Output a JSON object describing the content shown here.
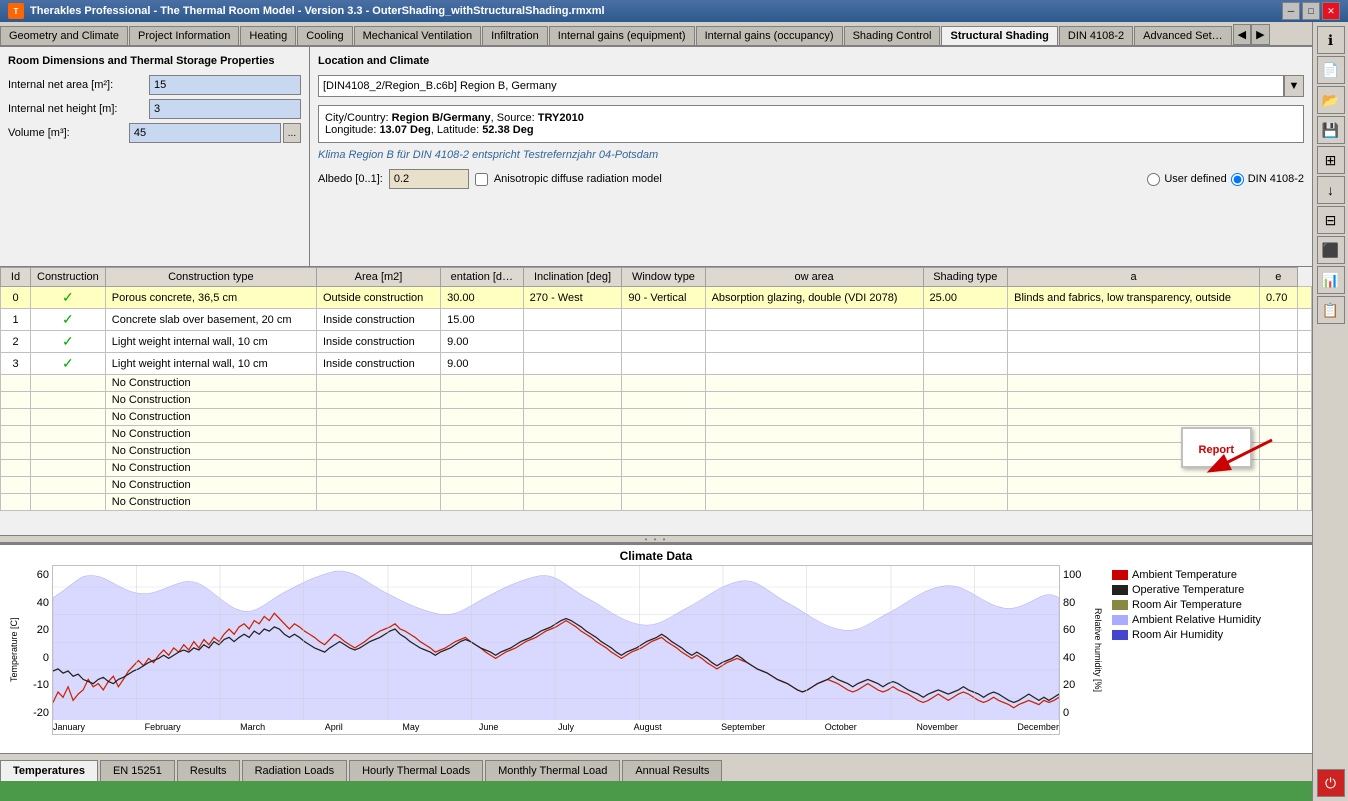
{
  "titleBar": {
    "title": "Therakles Professional - The Thermal Room Model - Version 3.3 - OuterShading_withStructuralShading.rmxml",
    "icon": "T",
    "minimize": "─",
    "maximize": "□",
    "close": "✕"
  },
  "tabs": [
    {
      "label": "Geometry and Climate",
      "active": false
    },
    {
      "label": "Project Information",
      "active": false
    },
    {
      "label": "Heating",
      "active": false
    },
    {
      "label": "Cooling",
      "active": false
    },
    {
      "label": "Mechanical Ventilation",
      "active": false
    },
    {
      "label": "Infiltration",
      "active": false
    },
    {
      "label": "Internal gains (equipment)",
      "active": false
    },
    {
      "label": "Internal gains (occupancy)",
      "active": false
    },
    {
      "label": "Shading Control",
      "active": false
    },
    {
      "label": "Structural Shading",
      "active": true
    },
    {
      "label": "DIN 4108-2",
      "active": false
    },
    {
      "label": "Advanced Set…",
      "active": false
    }
  ],
  "leftPanel": {
    "title": "Room Dimensions and Thermal Storage Properties",
    "fields": [
      {
        "label": "Internal net area [m²]:",
        "value": "15"
      },
      {
        "label": "Internal net height [m]:",
        "value": "3"
      },
      {
        "label": "Volume [m³]:",
        "value": "45"
      }
    ]
  },
  "climatePanel": {
    "title": "Location and Climate",
    "dropdown": "[DIN4108_2/Region_B.c6b] Region B, Germany",
    "infoCity": "Region B/Germany",
    "infoSource": "TRY2010",
    "infoLongitude": "13.07 Deg",
    "infoLatitude": "52.38 Deg",
    "klimaText": "Klima Region B für DIN 4108-2 entspricht Testrefernzjahr 04-Potsdam",
    "albedoLabel": "Albedo  [0..1]:",
    "albedoValue": "0.2",
    "anisotropicLabel": "Anisotropic diffuse radiation model",
    "radioUserDefined": "User defined",
    "radioDIN": "DIN 4108-2",
    "radioDINActive": true
  },
  "table": {
    "headers": [
      "Id",
      "Construction",
      "Construction type",
      "Area [m2]",
      "entation [d…",
      "Inclination [deg]",
      "Window type",
      "ow area",
      "Shading type",
      "a",
      "e"
    ],
    "rows": [
      {
        "id": "0",
        "check": true,
        "construction": "Porous concrete, 36,5 cm",
        "type": "Outside construction",
        "area": "30.00",
        "orient": "270 - West",
        "incl": "90 - Vertical",
        "windowType": "Absorption glazing, double (VDI 2078)",
        "winArea": "25.00",
        "shadingType": "Blinds and fabrics, low transparency, outside",
        "a": "0.70",
        "e": "",
        "bg": "yellow"
      },
      {
        "id": "1",
        "check": true,
        "construction": "Concrete slab over basement, 20 cm",
        "type": "Inside construction",
        "area": "15.00",
        "orient": "",
        "incl": "",
        "windowType": "",
        "winArea": "",
        "shadingType": "",
        "a": "",
        "e": "",
        "bg": "white"
      },
      {
        "id": "2",
        "check": true,
        "construction": "Light weight internal wall, 10 cm",
        "type": "Inside construction",
        "area": "9.00",
        "orient": "",
        "incl": "",
        "windowType": "",
        "winArea": "",
        "shadingType": "",
        "a": "",
        "e": "",
        "bg": "white"
      },
      {
        "id": "3",
        "check": true,
        "construction": "Light weight internal wall, 10 cm",
        "type": "Inside construction",
        "area": "9.00",
        "orient": "",
        "incl": "",
        "windowType": "",
        "winArea": "",
        "shadingType": "",
        "a": "",
        "e": "",
        "bg": "white"
      },
      {
        "id": "",
        "check": false,
        "construction": "No Construction",
        "type": "",
        "area": "",
        "orient": "",
        "incl": "",
        "windowType": "",
        "winArea": "",
        "shadingType": "",
        "a": "",
        "e": "",
        "bg": "empty"
      },
      {
        "id": "",
        "check": false,
        "construction": "No Construction",
        "type": "",
        "area": "",
        "orient": "",
        "incl": "",
        "windowType": "",
        "winArea": "",
        "shadingType": "",
        "a": "",
        "e": "",
        "bg": "empty"
      },
      {
        "id": "",
        "check": false,
        "construction": "No Construction",
        "type": "",
        "area": "",
        "orient": "",
        "incl": "",
        "windowType": "",
        "winArea": "",
        "shadingType": "",
        "a": "",
        "e": "",
        "bg": "empty"
      },
      {
        "id": "",
        "check": false,
        "construction": "No Construction",
        "type": "",
        "area": "",
        "orient": "",
        "incl": "",
        "windowType": "",
        "winArea": "",
        "shadingType": "",
        "a": "",
        "e": "",
        "bg": "empty"
      },
      {
        "id": "",
        "check": false,
        "construction": "No Construction",
        "type": "",
        "area": "",
        "orient": "",
        "incl": "",
        "windowType": "",
        "winArea": "",
        "shadingType": "",
        "a": "",
        "e": "",
        "bg": "empty"
      },
      {
        "id": "",
        "check": false,
        "construction": "No Construction",
        "type": "",
        "area": "",
        "orient": "",
        "incl": "",
        "windowType": "",
        "winArea": "",
        "shadingType": "",
        "a": "",
        "e": "",
        "bg": "empty"
      },
      {
        "id": "",
        "check": false,
        "construction": "No Construction",
        "type": "",
        "area": "",
        "orient": "",
        "incl": "",
        "windowType": "",
        "winArea": "",
        "shadingType": "",
        "a": "",
        "e": "",
        "bg": "empty"
      },
      {
        "id": "",
        "check": false,
        "construction": "No Construction",
        "type": "",
        "area": "",
        "orient": "",
        "incl": "",
        "windowType": "",
        "winArea": "",
        "shadingType": "",
        "a": "",
        "e": "",
        "bg": "empty"
      }
    ]
  },
  "report": {
    "label": "Report"
  },
  "chart": {
    "title": "Climate Data",
    "yLeftLabel": "Temperature [C]",
    "yRightLabel": "Relative humidity [%]",
    "xLabels": [
      "January",
      "February",
      "March",
      "April",
      "May",
      "June",
      "July",
      "August",
      "September",
      "October",
      "November",
      "December"
    ],
    "yLeftTicks": [
      "60",
      "40",
      "20",
      "0",
      "-20"
    ],
    "yRightTicks": [
      "100",
      "80",
      "60",
      "40",
      "20",
      "0"
    ],
    "legend": [
      {
        "color": "#cc0000",
        "label": "Ambient Temperature"
      },
      {
        "color": "#222222",
        "label": "Operative Temperature"
      },
      {
        "color": "#888844",
        "label": "Room Air Temperature"
      },
      {
        "color": "#aaaaff",
        "label": "Ambient Relative Humidity"
      },
      {
        "color": "#4444cc",
        "label": "Room Air Humidity"
      }
    ]
  },
  "bottomTabs": [
    {
      "label": "Temperatures",
      "active": true
    },
    {
      "label": "EN 15251",
      "active": false
    },
    {
      "label": "Results",
      "active": false
    },
    {
      "label": "Radiation Loads",
      "active": false
    },
    {
      "label": "Hourly Thermal Loads",
      "active": false
    },
    {
      "label": "Monthly Thermal Load",
      "active": false
    },
    {
      "label": "Annual Results",
      "active": false
    }
  ],
  "sidebar": {
    "buttons": [
      {
        "icon": "ℹ",
        "name": "info-button"
      },
      {
        "icon": "📄",
        "name": "new-button"
      },
      {
        "icon": "📂",
        "name": "open-button"
      },
      {
        "icon": "💾",
        "name": "save-button"
      },
      {
        "icon": "🖩",
        "name": "calculator-button"
      },
      {
        "icon": "⬇",
        "name": "download-button"
      },
      {
        "icon": "⊞",
        "name": "table-button"
      },
      {
        "icon": "🧱",
        "name": "material-button"
      },
      {
        "icon": "📊",
        "name": "chart-button"
      },
      {
        "icon": "📋",
        "name": "report-button"
      },
      {
        "icon": "⏻",
        "name": "power-button"
      }
    ]
  }
}
